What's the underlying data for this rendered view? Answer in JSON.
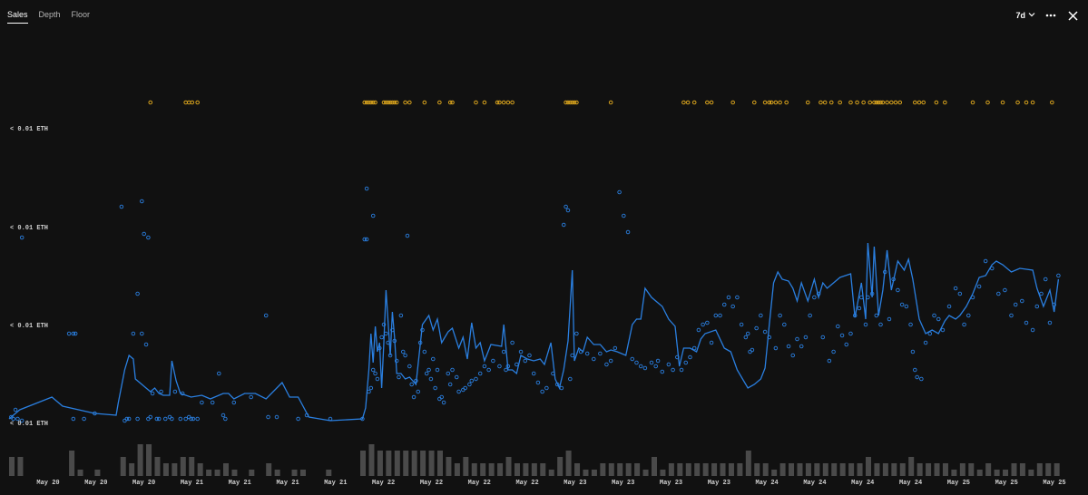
{
  "tabs": [
    {
      "label": "Sales",
      "active": true
    },
    {
      "label": "Depth",
      "active": false
    },
    {
      "label": "Floor",
      "active": false
    }
  ],
  "controls": {
    "range_label": "7d",
    "more_icon": "more-horizontal-icon",
    "close_icon": "close-icon"
  },
  "colors": {
    "background": "#111111",
    "line": "#2a7fe0",
    "points": "#2a7fe0",
    "listings": "#d7a21d",
    "volume": "#4a4a4a"
  },
  "chart_data": {
    "type": "scatter",
    "y_ticks": [
      "< 0.01 ETH",
      "< 0.01 ETH",
      "< 0.01 ETH",
      "< 0.01 ETH"
    ],
    "x_ticks": [
      "May 20",
      "May 20",
      "May 20",
      "May 21",
      "May 21",
      "May 21",
      "May 21",
      "May 22",
      "May 22",
      "May 22",
      "May 22",
      "May 23",
      "May 23",
      "May 23",
      "May 23",
      "May 24",
      "May 24",
      "May 24",
      "May 24",
      "May 25",
      "May 25",
      "May 25"
    ],
    "x_domain": [
      0,
      1000
    ],
    "y_domain": [
      0,
      100
    ],
    "line": [
      [
        0,
        3
      ],
      [
        10,
        8
      ],
      [
        40,
        15
      ],
      [
        50,
        10
      ],
      [
        80,
        6
      ],
      [
        100,
        5
      ],
      [
        102,
        12
      ],
      [
        108,
        30
      ],
      [
        112,
        38
      ],
      [
        116,
        36
      ],
      [
        118,
        25
      ],
      [
        124,
        22
      ],
      [
        128,
        20
      ],
      [
        132,
        18
      ],
      [
        136,
        20
      ],
      [
        140,
        17
      ],
      [
        144,
        16
      ],
      [
        150,
        16
      ],
      [
        152,
        35
      ],
      [
        156,
        24
      ],
      [
        160,
        17
      ],
      [
        170,
        15
      ],
      [
        180,
        16
      ],
      [
        188,
        14
      ],
      [
        200,
        17
      ],
      [
        205,
        17
      ],
      [
        210,
        14
      ],
      [
        220,
        17
      ],
      [
        230,
        17
      ],
      [
        240,
        14
      ],
      [
        255,
        23
      ],
      [
        262,
        15
      ],
      [
        270,
        15
      ],
      [
        280,
        4
      ],
      [
        300,
        2
      ],
      [
        330,
        3
      ],
      [
        333,
        9
      ],
      [
        336,
        30
      ],
      [
        338,
        50
      ],
      [
        340,
        34
      ],
      [
        342,
        54
      ],
      [
        344,
        40
      ],
      [
        346,
        45
      ],
      [
        348,
        20
      ],
      [
        350,
        45
      ],
      [
        352,
        74
      ],
      [
        356,
        38
      ],
      [
        358,
        62
      ],
      [
        360,
        48
      ],
      [
        362,
        28
      ],
      [
        366,
        28
      ],
      [
        370,
        25
      ],
      [
        374,
        26
      ],
      [
        380,
        22
      ],
      [
        386,
        55
      ],
      [
        392,
        60
      ],
      [
        396,
        52
      ],
      [
        400,
        58
      ],
      [
        404,
        45
      ],
      [
        410,
        51
      ],
      [
        414,
        53
      ],
      [
        420,
        42
      ],
      [
        424,
        48
      ],
      [
        428,
        36
      ],
      [
        432,
        56
      ],
      [
        436,
        42
      ],
      [
        440,
        45
      ],
      [
        444,
        35
      ],
      [
        446,
        38
      ],
      [
        450,
        44
      ],
      [
        460,
        43
      ],
      [
        462,
        55
      ],
      [
        466,
        30
      ],
      [
        470,
        30
      ],
      [
        474,
        28
      ],
      [
        478,
        38
      ],
      [
        484,
        36
      ],
      [
        490,
        35
      ],
      [
        496,
        36
      ],
      [
        500,
        33
      ],
      [
        506,
        45
      ],
      [
        510,
        25
      ],
      [
        514,
        20
      ],
      [
        518,
        30
      ],
      [
        522,
        46
      ],
      [
        526,
        85
      ],
      [
        528,
        35
      ],
      [
        532,
        42
      ],
      [
        536,
        40
      ],
      [
        540,
        48
      ],
      [
        546,
        44
      ],
      [
        552,
        44
      ],
      [
        558,
        40
      ],
      [
        562,
        41
      ],
      [
        568,
        40
      ],
      [
        576,
        38
      ],
      [
        582,
        55
      ],
      [
        586,
        58
      ],
      [
        590,
        58
      ],
      [
        594,
        75
      ],
      [
        600,
        70
      ],
      [
        610,
        65
      ],
      [
        616,
        58
      ],
      [
        622,
        54
      ],
      [
        626,
        32
      ],
      [
        630,
        42
      ],
      [
        636,
        42
      ],
      [
        642,
        40
      ],
      [
        646,
        47
      ],
      [
        650,
        50
      ],
      [
        660,
        52
      ],
      [
        668,
        42
      ],
      [
        674,
        40
      ],
      [
        680,
        30
      ],
      [
        690,
        20
      ],
      [
        696,
        22
      ],
      [
        702,
        25
      ],
      [
        706,
        31
      ],
      [
        710,
        55
      ],
      [
        714,
        78
      ],
      [
        718,
        84
      ],
      [
        722,
        80
      ],
      [
        728,
        79
      ],
      [
        732,
        75
      ],
      [
        736,
        68
      ],
      [
        740,
        78
      ],
      [
        746,
        68
      ],
      [
        752,
        80
      ],
      [
        756,
        70
      ],
      [
        760,
        78
      ],
      [
        764,
        75
      ],
      [
        770,
        78
      ],
      [
        776,
        81
      ],
      [
        786,
        83
      ],
      [
        790,
        59
      ],
      [
        796,
        78
      ],
      [
        800,
        58
      ],
      [
        802,
        100
      ],
      [
        806,
        70
      ],
      [
        808,
        98
      ],
      [
        812,
        60
      ],
      [
        816,
        74
      ],
      [
        820,
        96
      ],
      [
        824,
        74
      ],
      [
        830,
        90
      ],
      [
        836,
        85
      ],
      [
        840,
        91
      ],
      [
        844,
        80
      ],
      [
        850,
        58
      ],
      [
        856,
        50
      ],
      [
        862,
        52
      ],
      [
        868,
        50
      ],
      [
        874,
        57
      ],
      [
        878,
        60
      ],
      [
        884,
        58
      ],
      [
        888,
        60
      ],
      [
        894,
        65
      ],
      [
        900,
        72
      ],
      [
        906,
        81
      ],
      [
        912,
        82
      ],
      [
        918,
        88
      ],
      [
        922,
        90
      ],
      [
        928,
        88
      ],
      [
        936,
        84
      ],
      [
        944,
        86
      ],
      [
        956,
        85
      ],
      [
        960,
        75
      ],
      [
        966,
        65
      ],
      [
        972,
        74
      ],
      [
        976,
        62
      ],
      [
        980,
        80
      ]
    ],
    "points": [
      [
        2,
        4
      ],
      [
        4,
        3
      ],
      [
        6,
        8
      ],
      [
        8,
        3
      ],
      [
        12,
        2
      ],
      [
        12,
        103
      ],
      [
        56,
        50
      ],
      [
        60,
        50
      ],
      [
        60,
        3
      ],
      [
        62,
        50
      ],
      [
        70,
        3
      ],
      [
        80,
        6
      ],
      [
        105,
        120
      ],
      [
        108,
        2
      ],
      [
        110,
        3
      ],
      [
        112,
        3
      ],
      [
        116,
        50
      ],
      [
        120,
        72
      ],
      [
        120,
        3
      ],
      [
        124,
        50
      ],
      [
        124,
        123
      ],
      [
        126,
        105
      ],
      [
        128,
        44
      ],
      [
        130,
        103
      ],
      [
        130,
        3
      ],
      [
        132,
        4
      ],
      [
        134,
        17
      ],
      [
        138,
        3
      ],
      [
        140,
        3
      ],
      [
        142,
        18
      ],
      [
        146,
        3
      ],
      [
        150,
        4
      ],
      [
        152,
        3
      ],
      [
        155,
        18
      ],
      [
        160,
        3
      ],
      [
        162,
        17
      ],
      [
        165,
        3
      ],
      [
        168,
        4
      ],
      [
        170,
        3
      ],
      [
        172,
        3
      ],
      [
        176,
        3
      ],
      [
        180,
        12
      ],
      [
        190,
        12
      ],
      [
        196,
        28
      ],
      [
        200,
        5
      ],
      [
        202,
        3
      ],
      [
        210,
        12
      ],
      [
        226,
        15
      ],
      [
        240,
        60
      ],
      [
        242,
        4
      ],
      [
        250,
        4
      ],
      [
        270,
        3
      ],
      [
        278,
        5
      ],
      [
        300,
        3
      ],
      [
        330,
        3
      ],
      [
        332,
        102
      ],
      [
        334,
        102
      ],
      [
        334,
        130
      ],
      [
        336,
        18
      ],
      [
        338,
        20
      ],
      [
        340,
        30
      ],
      [
        340,
        115
      ],
      [
        342,
        28
      ],
      [
        344,
        25
      ],
      [
        346,
        42
      ],
      [
        348,
        48
      ],
      [
        350,
        55
      ],
      [
        352,
        50
      ],
      [
        354,
        45
      ],
      [
        356,
        38
      ],
      [
        358,
        52
      ],
      [
        360,
        46
      ],
      [
        362,
        35
      ],
      [
        364,
        26
      ],
      [
        366,
        60
      ],
      [
        368,
        40
      ],
      [
        370,
        38
      ],
      [
        372,
        104
      ],
      [
        374,
        32
      ],
      [
        376,
        22
      ],
      [
        378,
        15
      ],
      [
        380,
        24
      ],
      [
        382,
        18
      ],
      [
        384,
        45
      ],
      [
        386,
        52
      ],
      [
        388,
        40
      ],
      [
        390,
        28
      ],
      [
        392,
        30
      ],
      [
        394,
        25
      ],
      [
        396,
        36
      ],
      [
        398,
        20
      ],
      [
        400,
        30
      ],
      [
        402,
        14
      ],
      [
        404,
        15
      ],
      [
        406,
        12
      ],
      [
        410,
        28
      ],
      [
        412,
        22
      ],
      [
        414,
        30
      ],
      [
        418,
        26
      ],
      [
        420,
        18
      ],
      [
        424,
        19
      ],
      [
        426,
        20
      ],
      [
        430,
        22
      ],
      [
        432,
        24
      ],
      [
        436,
        25
      ],
      [
        440,
        28
      ],
      [
        444,
        32
      ],
      [
        448,
        30
      ],
      [
        452,
        35
      ],
      [
        458,
        32
      ],
      [
        462,
        40
      ],
      [
        464,
        30
      ],
      [
        466,
        32
      ],
      [
        470,
        45
      ],
      [
        474,
        33
      ],
      [
        478,
        40
      ],
      [
        482,
        35
      ],
      [
        486,
        38
      ],
      [
        490,
        28
      ],
      [
        494,
        23
      ],
      [
        498,
        18
      ],
      [
        502,
        20
      ],
      [
        508,
        28
      ],
      [
        512,
        22
      ],
      [
        516,
        20
      ],
      [
        518,
        110
      ],
      [
        520,
        120
      ],
      [
        522,
        118
      ],
      [
        524,
        25
      ],
      [
        526,
        38
      ],
      [
        530,
        50
      ],
      [
        534,
        40
      ],
      [
        540,
        39
      ],
      [
        546,
        36
      ],
      [
        552,
        39
      ],
      [
        558,
        33
      ],
      [
        562,
        35
      ],
      [
        566,
        42
      ],
      [
        570,
        128
      ],
      [
        574,
        115
      ],
      [
        578,
        106
      ],
      [
        582,
        36
      ],
      [
        586,
        34
      ],
      [
        590,
        32
      ],
      [
        594,
        31
      ],
      [
        600,
        34
      ],
      [
        604,
        32
      ],
      [
        606,
        35
      ],
      [
        610,
        29
      ],
      [
        616,
        33
      ],
      [
        620,
        30
      ],
      [
        624,
        37
      ],
      [
        628,
        30
      ],
      [
        632,
        34
      ],
      [
        636,
        37
      ],
      [
        640,
        42
      ],
      [
        644,
        52
      ],
      [
        648,
        55
      ],
      [
        652,
        56
      ],
      [
        656,
        45
      ],
      [
        660,
        60
      ],
      [
        664,
        60
      ],
      [
        668,
        66
      ],
      [
        672,
        70
      ],
      [
        676,
        65
      ],
      [
        680,
        70
      ],
      [
        684,
        55
      ],
      [
        688,
        48
      ],
      [
        690,
        50
      ],
      [
        692,
        40
      ],
      [
        694,
        41
      ],
      [
        698,
        53
      ],
      [
        702,
        60
      ],
      [
        706,
        51
      ],
      [
        710,
        48
      ],
      [
        716,
        42
      ],
      [
        720,
        60
      ],
      [
        724,
        55
      ],
      [
        728,
        43
      ],
      [
        732,
        38
      ],
      [
        736,
        47
      ],
      [
        740,
        43
      ],
      [
        744,
        48
      ],
      [
        748,
        60
      ],
      [
        752,
        70
      ],
      [
        756,
        72
      ],
      [
        760,
        48
      ],
      [
        766,
        35
      ],
      [
        770,
        40
      ],
      [
        774,
        54
      ],
      [
        778,
        49
      ],
      [
        782,
        44
      ],
      [
        786,
        50
      ],
      [
        790,
        60
      ],
      [
        794,
        64
      ],
      [
        796,
        70
      ],
      [
        800,
        55
      ],
      [
        802,
        70
      ],
      [
        806,
        72
      ],
      [
        810,
        60
      ],
      [
        814,
        55
      ],
      [
        818,
        84
      ],
      [
        822,
        58
      ],
      [
        826,
        80
      ],
      [
        830,
        74
      ],
      [
        834,
        66
      ],
      [
        838,
        65
      ],
      [
        842,
        55
      ],
      [
        844,
        40
      ],
      [
        846,
        30
      ],
      [
        848,
        26
      ],
      [
        852,
        25
      ],
      [
        856,
        45
      ],
      [
        860,
        50
      ],
      [
        864,
        60
      ],
      [
        868,
        58
      ],
      [
        872,
        52
      ],
      [
        878,
        65
      ],
      [
        884,
        75
      ],
      [
        888,
        72
      ],
      [
        892,
        55
      ],
      [
        896,
        60
      ],
      [
        900,
        70
      ],
      [
        906,
        76
      ],
      [
        912,
        90
      ],
      [
        918,
        86
      ],
      [
        924,
        72
      ],
      [
        930,
        74
      ],
      [
        936,
        60
      ],
      [
        940,
        66
      ],
      [
        946,
        68
      ],
      [
        950,
        56
      ],
      [
        956,
        52
      ],
      [
        960,
        65
      ],
      [
        964,
        72
      ],
      [
        968,
        80
      ],
      [
        972,
        56
      ],
      [
        976,
        66
      ],
      [
        980,
        82
      ]
    ],
    "listings": [
      132,
      165,
      168,
      171,
      176,
      332,
      334,
      336,
      338,
      340,
      342,
      350,
      352,
      354,
      356,
      358,
      360,
      362,
      370,
      374,
      388,
      402,
      412,
      414,
      436,
      444,
      456,
      458,
      462,
      466,
      470,
      520,
      522,
      524,
      526,
      528,
      530,
      562,
      630,
      634,
      640,
      652,
      656,
      676,
      696,
      706,
      710,
      712,
      716,
      720,
      726,
      746,
      758,
      762,
      768,
      776,
      786,
      792,
      798,
      804,
      808,
      810,
      812,
      814,
      816,
      820,
      824,
      828,
      832,
      846,
      850,
      854,
      866,
      874,
      900,
      914,
      928,
      942,
      950,
      956,
      974
    ]
  }
}
